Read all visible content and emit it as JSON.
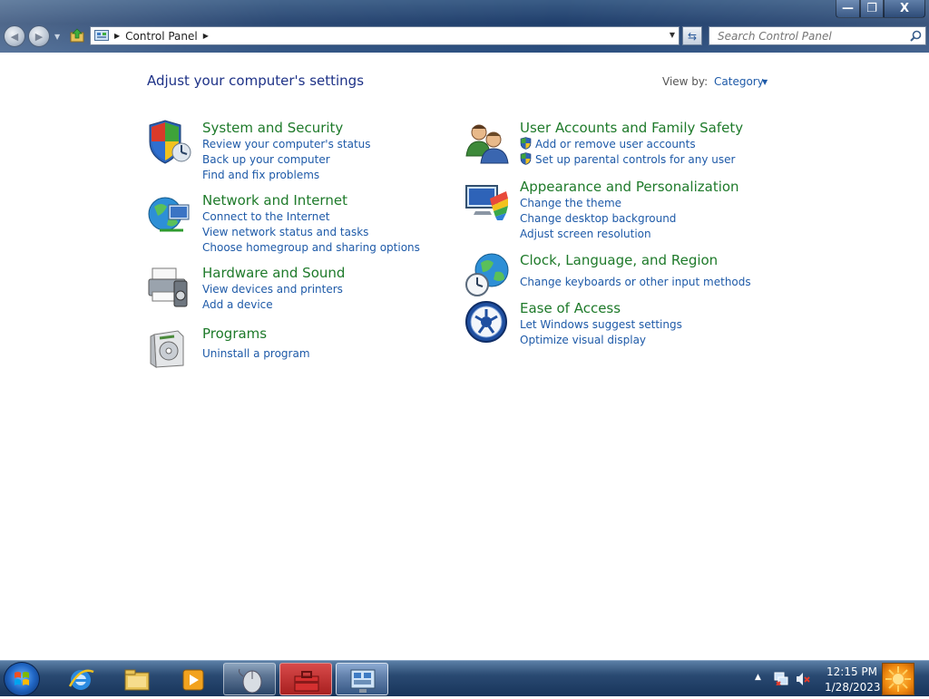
{
  "window": {
    "address": {
      "segment": "Control Panel"
    },
    "search": {
      "placeholder": "Search Control Panel"
    },
    "caption": {
      "minimize": "—",
      "maximize": "❐",
      "close": "X"
    }
  },
  "page": {
    "title": "Adjust your computer's settings",
    "view_by_label": "View by:",
    "view_by_value": "Category"
  },
  "categories": {
    "system_security": {
      "title": "System and Security",
      "links": [
        "Review your computer's status",
        "Back up your computer",
        "Find and fix problems"
      ]
    },
    "network_internet": {
      "title": "Network and Internet",
      "links": [
        "Connect to the Internet",
        "View network status and tasks",
        "Choose homegroup and sharing options"
      ]
    },
    "hardware_sound": {
      "title": "Hardware and Sound",
      "links": [
        "View devices and printers",
        "Add a device"
      ]
    },
    "programs": {
      "title": "Programs",
      "links": [
        "Uninstall a program"
      ]
    },
    "user_accounts": {
      "title": "User Accounts and Family Safety",
      "links": [
        "Add or remove user accounts",
        "Set up parental controls for any user"
      ]
    },
    "appearance": {
      "title": "Appearance and Personalization",
      "links": [
        "Change the theme",
        "Change desktop background",
        "Adjust screen resolution"
      ]
    },
    "clock_region": {
      "title": "Clock, Language, and Region",
      "links": [
        "Change keyboards or other input methods"
      ]
    },
    "ease_access": {
      "title": "Ease of Access",
      "links": [
        "Let Windows suggest settings",
        "Optimize visual display"
      ]
    }
  },
  "taskbar": {
    "apps": [
      "start-orb",
      "internet-explorer",
      "windows-explorer",
      "media-player",
      "mouse-app",
      "toolbox-app",
      "control-panel-app"
    ],
    "clock": {
      "time": "12:15 PM",
      "date": "1/28/2023"
    }
  }
}
